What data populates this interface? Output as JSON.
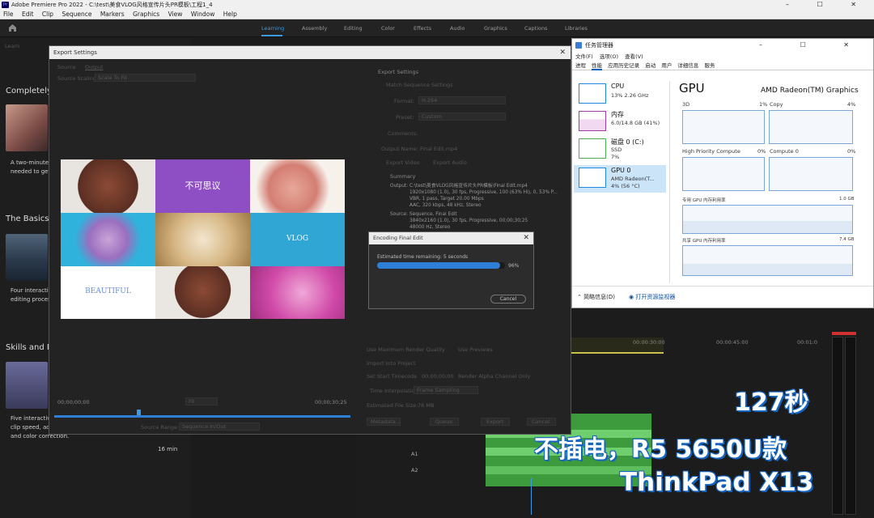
{
  "titlebar": {
    "app_icon": "Pr",
    "title": "Adobe Premiere Pro 2022 - C:\\test\\美食VLOG风格宣传片头PR模板\\工程1_4",
    "window_controls": "– ☐ ✕"
  },
  "menubar": [
    "File",
    "Edit",
    "Clip",
    "Sequence",
    "Markers",
    "Graphics",
    "View",
    "Window",
    "Help"
  ],
  "workspace": {
    "tabs": [
      "Learning",
      "Assembly",
      "Editing",
      "Color",
      "Effects",
      "Audio",
      "Graphics",
      "Captions",
      "Libraries"
    ],
    "active": "Learning"
  },
  "learn": {
    "header": "Learn",
    "sections": [
      {
        "title": "Completely",
        "desc": [
          "A two-minute",
          "needed to get"
        ]
      },
      {
        "title": "The Basics",
        "desc": [
          "Four interacti",
          "editing proces"
        ]
      },
      {
        "title": "Skills and Pr",
        "desc": [
          "Five interactive tutorials",
          "clip speed, ad",
          "and color correction."
        ],
        "duration": "16 min"
      }
    ]
  },
  "export_dialog": {
    "title": "Export Settings",
    "source_tab": "Source",
    "output_tab": "Output",
    "source_scaling_label": "Source Scaling:",
    "source_scaling_value": "Scale To Fit",
    "collage_labels": {
      "center_top": "不可思议",
      "right_mid": "VLOG",
      "left_bottom": "BEAUTIFUL"
    },
    "timecode_in": "00;00;00;00",
    "timecode_out": "00;00;30;25",
    "fit": "Fit",
    "source_range_label": "Source Range:",
    "source_range_value": "Sequence In/Out",
    "export_settings_header": "Export Settings",
    "match_sequence": "Match Sequence Settings",
    "format_label": "Format:",
    "format_value": "H.264",
    "preset_label": "Preset:",
    "preset_value": "Custom",
    "comments_label": "Comments:",
    "output_name_label": "Output Name:",
    "output_name_value": "Final Edit.mp4",
    "export_video": "Export Video",
    "export_audio": "Export Audio",
    "summary_header": "Summary",
    "output_label": "Output:",
    "output_lines": [
      "C:\\test\\美食VLOG风格宣传片头PR模板\\Final Edit.mp4",
      "1920x1080 (1.0), 30 fps, Progressive, 100 (63% Hi), 0, 53% P...",
      "VBR, 1 pass, Target 20.00 Mbps",
      "AAC, 320 kbps, 48 kHz, Stereo"
    ],
    "source_label": "Source:",
    "source_lines": [
      "Sequence, Final Edit",
      "3840x2160 (1.0), 30 fps, Progressive, 00;00;30;25",
      "48000 Hz, Stereo"
    ],
    "use_max_render": "Use Maximum Render Quality",
    "use_previews": "Use Previews",
    "import_into_project": "Import Into Project",
    "set_start_timecode": "Set Start Timecode",
    "start_timecode": "00;00;00;00",
    "render_alpha": "Render Alpha Channel Only",
    "time_interpolation_label": "Time Interpolation:",
    "time_interpolation_value": "Frame Sampling",
    "file_size_label": "Estimated File Size:",
    "file_size_value": "76 MB",
    "buttons": [
      "Metadata...",
      "Queue",
      "Export",
      "Cancel"
    ]
  },
  "encoding_dialog": {
    "title": "Encoding Final Edit",
    "remaining": "Estimated time remaining: 5 seconds",
    "percent_text": "96%",
    "progress": 0.96,
    "cancel": "Cancel"
  },
  "task_manager": {
    "title": "任务管理器",
    "window_controls": "– ☐ ✕",
    "menu": [
      "文件(F)",
      "选项(O)",
      "查看(V)"
    ],
    "tabs": [
      "进程",
      "性能",
      "应用历史记录",
      "启动",
      "用户",
      "详细信息",
      "服务"
    ],
    "active_tab": "性能",
    "items": [
      {
        "name": "CPU",
        "sub1": "13% 2.26 GHz",
        "sub2": ""
      },
      {
        "name": "内存",
        "sub1": "6.0/14.8 GB (41%)",
        "sub2": ""
      },
      {
        "name": "磁盘 0 (C:)",
        "sub1": "SSD",
        "sub2": "7%"
      },
      {
        "name": "GPU 0",
        "sub1": "AMD Radeon(T...",
        "sub2": "4% (56 °C)"
      }
    ],
    "gpu_header": "GPU",
    "gpu_model": "AMD Radeon(TM) Graphics",
    "graphs": [
      {
        "label": "3D",
        "value": "1%"
      },
      {
        "label": "Copy",
        "value": "4%"
      },
      {
        "label": "High Priority Compute",
        "value": "0%"
      },
      {
        "label": "Compute 0",
        "value": "0%"
      }
    ],
    "dedicated_label": "专用 GPU 内存利用率",
    "dedicated_max": "1.0 GB",
    "shared_label": "共享 GPU 内存利用率",
    "shared_max": "7.4 GB",
    "footer_brief": "简略信息(D)",
    "footer_monitor": "打开资源监视器"
  },
  "timeline": {
    "time1": "00:00:30:00",
    "time2": "00:00:45:00",
    "time3": "00:01:0",
    "tracks": [
      "A1",
      "A2"
    ]
  },
  "overlay": {
    "line1": "127秒",
    "line2": "不插电，R5 5650U款",
    "line3": "ThinkPad X13"
  },
  "colors": {
    "accent_blue": "#3b9ae1",
    "overlay_stroke": "#1565c0",
    "progress": "#2f7fd8",
    "purple": "#8e4fc4",
    "cyan": "#2fb2dc",
    "magenta": "#d04aa8",
    "timeline_green": "#4db34d"
  }
}
